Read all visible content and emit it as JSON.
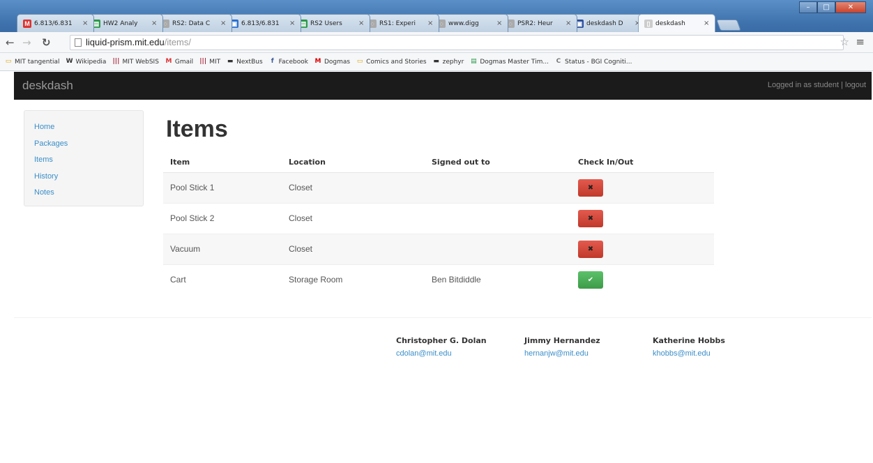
{
  "browser": {
    "tabs": [
      {
        "title": "6.813/6.831",
        "favicon": "M",
        "fav_color": "#d33"
      },
      {
        "title": "HW2 Analy",
        "favicon": "▤",
        "fav_color": "#2a9a4a"
      },
      {
        "title": "RS2: Data C",
        "favicon": "◌",
        "fav_color": "#aaa"
      },
      {
        "title": "6.813/6.831",
        "favicon": "▣",
        "fav_color": "#2b6fd1"
      },
      {
        "title": "RS2 Users",
        "favicon": "▤",
        "fav_color": "#2a9a4a"
      },
      {
        "title": "RS1: Experi",
        "favicon": "◌",
        "fav_color": "#aaa"
      },
      {
        "title": "www.digg",
        "favicon": "◌",
        "fav_color": "#aaa"
      },
      {
        "title": "PSR2: Heur",
        "favicon": "◌",
        "fav_color": "#aaa"
      },
      {
        "title": "deskdash D",
        "favicon": "▣",
        "fav_color": "#2b4f9e"
      },
      {
        "title": "deskdash",
        "favicon": "▯",
        "fav_color": "#ccc"
      }
    ],
    "active_tab": 9,
    "url_host": "liquid-prism.mit.edu",
    "url_path": "/items/",
    "bookmarks": [
      {
        "label": "MIT tangential",
        "icon": "▭",
        "color": "#d9a400"
      },
      {
        "label": "Wikipedia",
        "icon": "W",
        "color": "#333"
      },
      {
        "label": "MIT WebSIS",
        "icon": "|||",
        "color": "#a31f34"
      },
      {
        "label": "Gmail",
        "icon": "M",
        "color": "#d33"
      },
      {
        "label": "MIT",
        "icon": "|||",
        "color": "#a31f34"
      },
      {
        "label": "NextBus",
        "icon": "▬",
        "color": "#333"
      },
      {
        "label": "Facebook",
        "icon": "f",
        "color": "#3b5998"
      },
      {
        "label": "Dogmas",
        "icon": "M",
        "color": "#d00"
      },
      {
        "label": "Comics and Stories",
        "icon": "▭",
        "color": "#d9a400"
      },
      {
        "label": "zephyr",
        "icon": "▬",
        "color": "#333"
      },
      {
        "label": "Dogmas Master Tim...",
        "icon": "▤",
        "color": "#2a9a4a"
      },
      {
        "label": "Status - BGI Cogniti...",
        "icon": "C",
        "color": "#777"
      }
    ]
  },
  "app": {
    "brand": "deskdash",
    "login_text": "Logged in as student | logout"
  },
  "sidebar": {
    "items": [
      "Home",
      "Packages",
      "Items",
      "History",
      "Notes"
    ]
  },
  "page": {
    "title": "Items",
    "columns": [
      "Item",
      "Location",
      "Signed out to",
      "Check In/Out"
    ],
    "rows": [
      {
        "item": "Pool Stick 1",
        "location": "Closet",
        "signed_out_to": "",
        "action": "✖",
        "status": "out"
      },
      {
        "item": "Pool Stick 2",
        "location": "Closet",
        "signed_out_to": "",
        "action": "✖",
        "status": "out"
      },
      {
        "item": "Vacuum",
        "location": "Closet",
        "signed_out_to": "",
        "action": "✖",
        "status": "out"
      },
      {
        "item": "Cart",
        "location": "Storage Room",
        "signed_out_to": "Ben Bitdiddle",
        "action": "✔",
        "status": "in"
      }
    ]
  },
  "footer": {
    "contacts": [
      {
        "name": "Christopher G. Dolan",
        "email": "cdolan@mit.edu"
      },
      {
        "name": "Jimmy Hernandez",
        "email": "hernanjw@mit.edu"
      },
      {
        "name": "Katherine Hobbs",
        "email": "khobbs@mit.edu"
      }
    ]
  },
  "colors": {
    "navbar": "#1b1b1b",
    "link": "#3a8ec8",
    "danger": "#d9534f",
    "success": "#5cb85c"
  }
}
